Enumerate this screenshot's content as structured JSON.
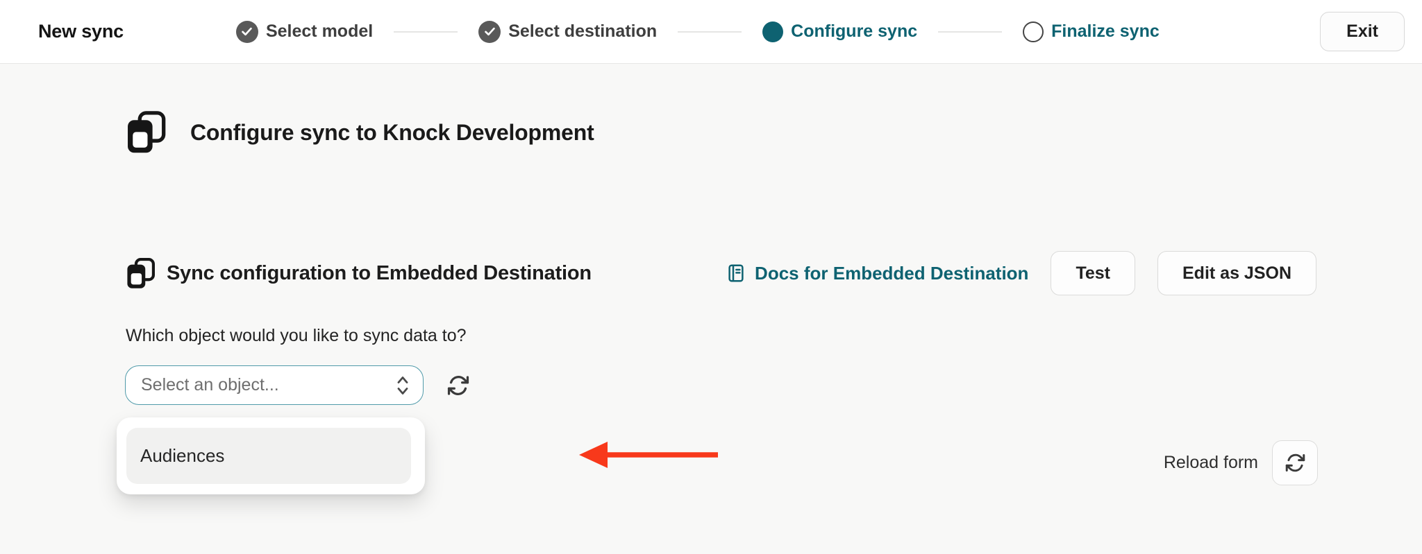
{
  "colors": {
    "accent_teal": "#0e6271",
    "active_dot_teal": "#0e6271",
    "select_focus_border": "#4f9aa9",
    "annotation_arrow_red": "#f8391b",
    "completed_step_gray": "#595959",
    "page_background": "#f8f8f7"
  },
  "header": {
    "title": "New sync",
    "exit_label": "Exit",
    "steps": [
      {
        "label": "Select model",
        "state": "completed"
      },
      {
        "label": "Select destination",
        "state": "completed"
      },
      {
        "label": "Configure sync",
        "state": "active"
      },
      {
        "label": "Finalize sync",
        "state": "upcoming"
      }
    ]
  },
  "main": {
    "heading": "Configure sync to Knock Development",
    "section": {
      "title": "Sync configuration to Embedded Destination",
      "docs_link": "Docs for Embedded Destination",
      "test_button": "Test",
      "edit_json_button": "Edit as JSON"
    },
    "form": {
      "question": "Which object would you like to sync data to?",
      "select_placeholder": "Select an object...",
      "options": [
        "Audiences"
      ],
      "reload_label": "Reload form"
    }
  },
  "icons": {
    "destination_icon": "stacked-windows",
    "docs_icon": "book",
    "select_chevron_icon": "up-down-chevrons",
    "refresh_icon": "circular-arrows",
    "check_icon": "checkmark",
    "annotation_arrow": "red-arrow-pointing-left"
  }
}
